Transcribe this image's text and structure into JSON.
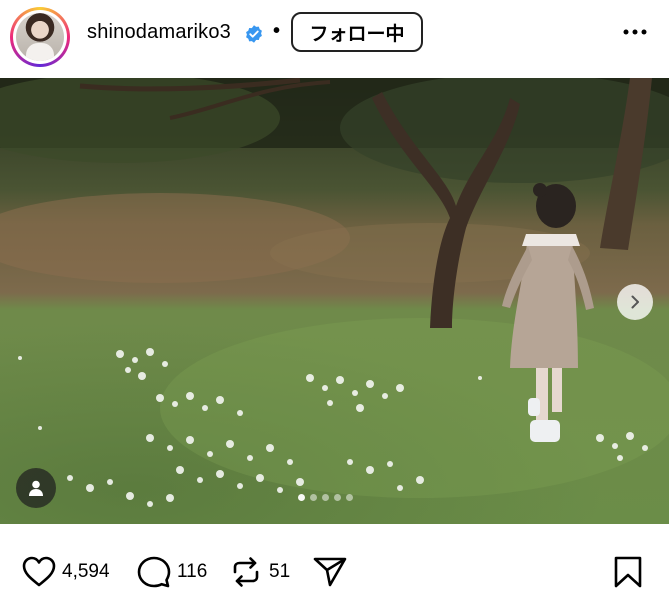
{
  "post": {
    "username": "shinodamariko3",
    "separator": "•",
    "follow_label": "フォロー中",
    "verified": true,
    "more_icon": "more-horizontal-icon"
  },
  "actions": {
    "likes": "4,594",
    "comments": "116",
    "reposts": "51"
  },
  "carousel": {
    "slide_count": 5,
    "active_index": 0
  },
  "colors": {
    "verified_blue": "#3897f0",
    "avatar_ring": "#ee2a7b"
  }
}
